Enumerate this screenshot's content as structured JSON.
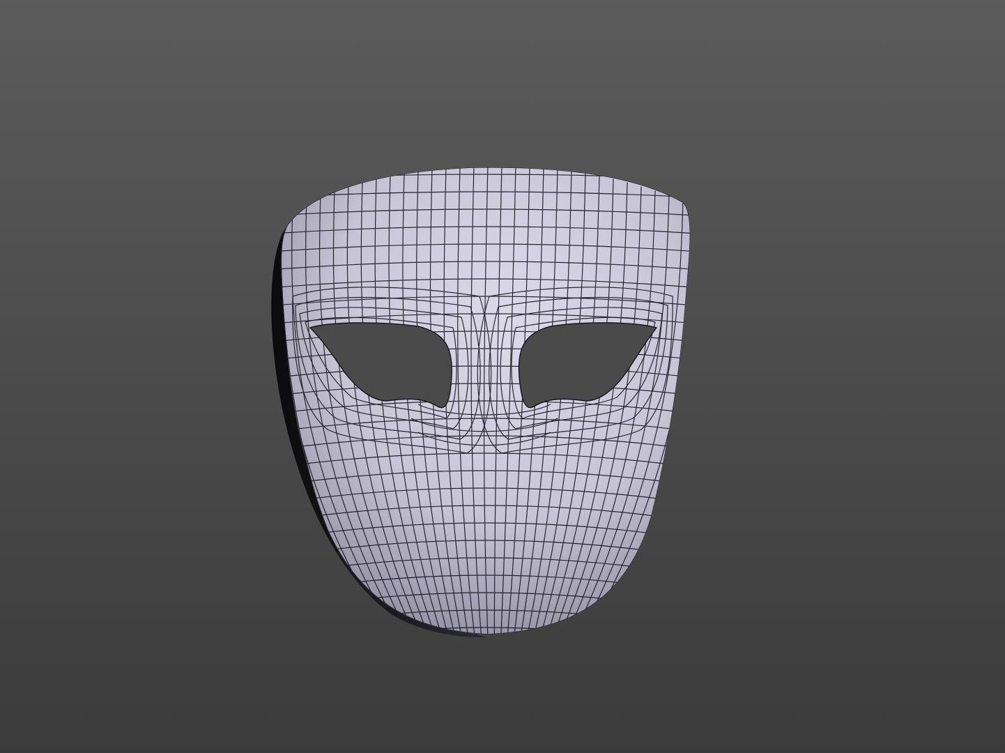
{
  "scene": {
    "subject": "wireframe-mask-model",
    "text_labels": []
  },
  "colors": {
    "background_top": "#5a5a5a",
    "background_bottom": "#3a3a3a",
    "mask_light": "#d4d2e4",
    "mask_shadow": "#6a6878",
    "wire": "#14141c",
    "eye_hole": "#4a4a4a"
  }
}
